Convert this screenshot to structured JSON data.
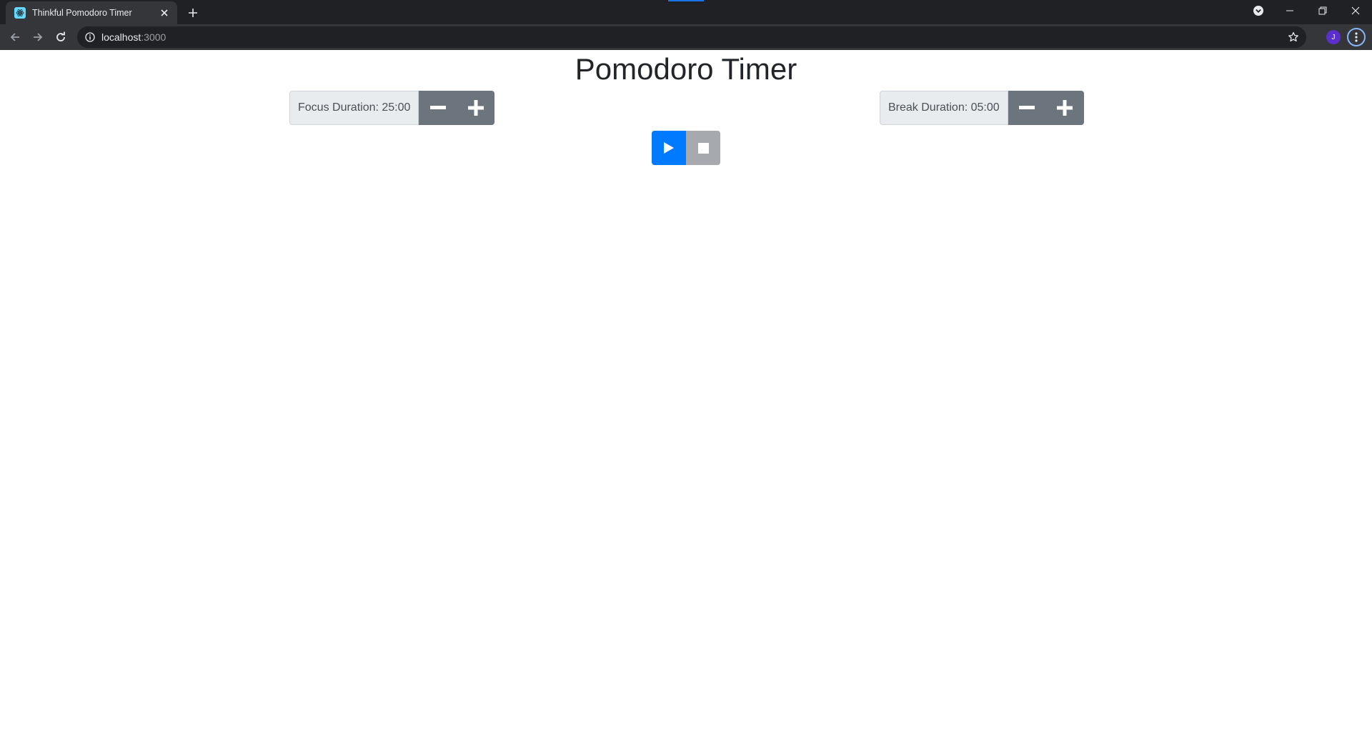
{
  "browser": {
    "tab_title": "Thinkful Pomodoro Timer",
    "url_host": "localhost",
    "url_port": ":3000",
    "avatar_initial": "J",
    "accent_color": "#1a73e8"
  },
  "icons": {
    "favicon": "react-logo-icon",
    "tab_close": "close-icon",
    "new_tab": "plus-icon",
    "back": "arrow-left-icon",
    "forward": "arrow-right-icon",
    "reload": "reload-icon",
    "info": "info-icon",
    "bookmark": "star-icon",
    "menu": "kebab-menu-icon"
  },
  "page": {
    "title": "Pomodoro Timer",
    "focus": {
      "label": "Focus Duration: 25:00",
      "value": "25:00"
    },
    "break": {
      "label": "Break Duration: 05:00",
      "value": "05:00"
    },
    "colors": {
      "play": "#007bff",
      "stop": "#a6aaae",
      "stepper": "#6c757d"
    }
  }
}
